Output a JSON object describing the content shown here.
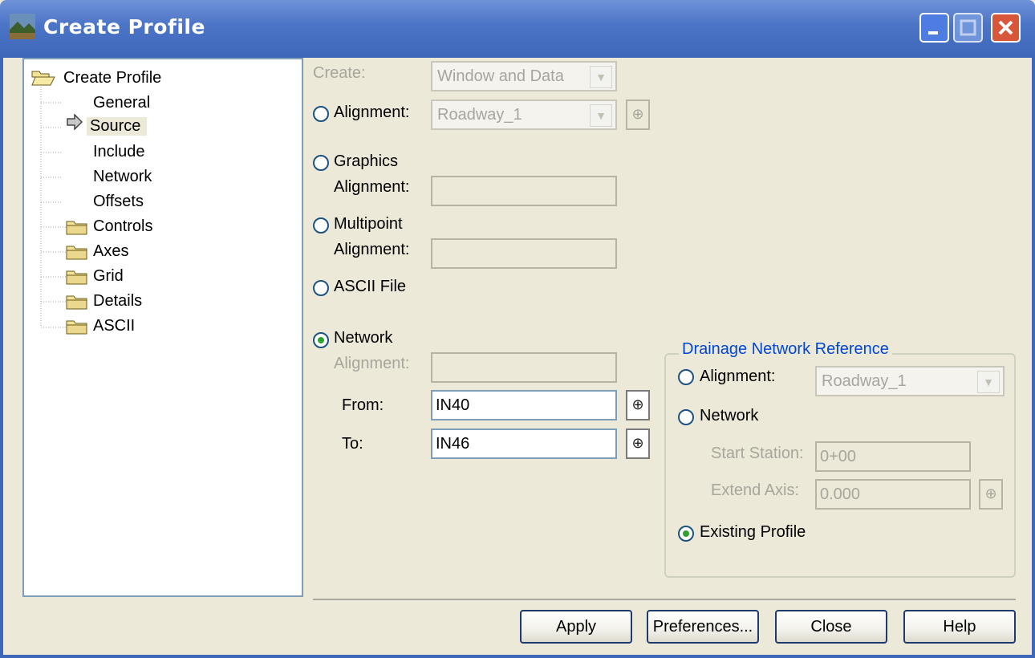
{
  "window": {
    "title": "Create Profile"
  },
  "tree": {
    "items": [
      {
        "label": "Create Profile",
        "kind": "open-folder"
      },
      {
        "label": "General",
        "kind": "leaf"
      },
      {
        "label": "Source",
        "kind": "leaf-selected"
      },
      {
        "label": "Include",
        "kind": "leaf"
      },
      {
        "label": "Network",
        "kind": "leaf"
      },
      {
        "label": "Offsets",
        "kind": "leaf"
      },
      {
        "label": "Controls",
        "kind": "folder"
      },
      {
        "label": "Axes",
        "kind": "folder"
      },
      {
        "label": "Grid",
        "kind": "folder"
      },
      {
        "label": "Details",
        "kind": "folder"
      },
      {
        "label": "ASCII",
        "kind": "folder"
      }
    ]
  },
  "source": {
    "create_label": "Create:",
    "create_value": "Window and Data",
    "alignment_label": "Alignment:",
    "alignment_value": "Roadway_1",
    "graphics_label": "Graphics",
    "graphics_alignment_label": "Alignment:",
    "multipoint_label": "Multipoint",
    "multipoint_alignment_label": "Alignment:",
    "ascii_label": "ASCII File",
    "network_label": "Network",
    "network_alignment_label": "Alignment:",
    "from_label": "From:",
    "from_value": "IN40",
    "to_label": "To:",
    "to_value": "IN46",
    "selected_option": "Network"
  },
  "drainage": {
    "title": "Drainage Network Reference",
    "alignment_label": "Alignment:",
    "alignment_value": "Roadway_1",
    "network_label": "Network",
    "start_station_label": "Start Station:",
    "start_station_value": "0+00",
    "extend_axis_label": "Extend Axis:",
    "extend_axis_value": "0.000",
    "existing_profile_label": "Existing Profile",
    "selected_option": "Existing Profile"
  },
  "buttons": {
    "apply": "Apply",
    "preferences": "Preferences...",
    "close": "Close",
    "help": "Help"
  },
  "icons": {
    "app": "landscape-icon",
    "pick": "crosshair-icon",
    "tree_pointer": "arrow-right-icon",
    "folder": "folder-icon"
  }
}
